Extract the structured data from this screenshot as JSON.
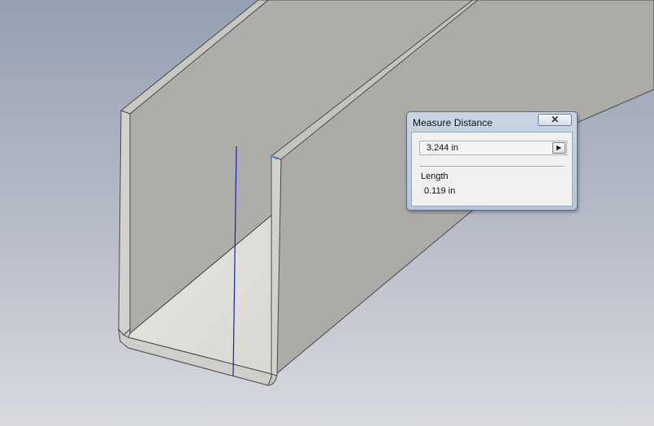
{
  "dialog": {
    "title": "Measure Distance",
    "close_symbol": "✕",
    "distance_value": "3.244 in",
    "arrow_symbol": "▶",
    "length_label": "Length",
    "length_value": "0.119 in"
  },
  "icons": {
    "close": "close-icon",
    "expand": "expand-arrow-icon"
  },
  "colors": {
    "background_top": "#98a2b6",
    "background_bottom": "#d7d9de",
    "part_face": "#aeadaa",
    "part_edge": "#4a4a4a",
    "inner_floor": "#e1e0dc",
    "measure_line": "#1a22b5"
  }
}
